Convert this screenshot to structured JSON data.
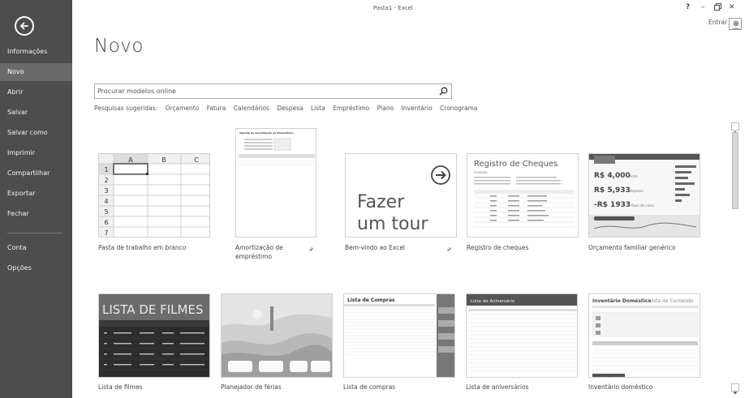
{
  "window": {
    "title": "Pasta1 - Excel",
    "help": "?",
    "minimize": "–",
    "restore": "🗗",
    "close": "✕",
    "signin": "Entrar"
  },
  "sidebar": {
    "items": [
      {
        "label": "Informações"
      },
      {
        "label": "Novo",
        "active": true
      },
      {
        "label": "Abrir"
      },
      {
        "label": "Salvar"
      },
      {
        "label": "Salvar como"
      },
      {
        "label": "Imprimir"
      },
      {
        "label": "Compartilhar"
      },
      {
        "label": "Exportar"
      },
      {
        "label": "Fechar"
      },
      {
        "label": "Conta"
      },
      {
        "label": "Opções"
      }
    ]
  },
  "main": {
    "heading": "Novo",
    "search": {
      "placeholder": "Procurar modelos online"
    },
    "suggestions": {
      "label": "Pesquisas sugeridas:",
      "items": [
        "Orçamento",
        "Fatura",
        "Calendários",
        "Despesa",
        "Lista",
        "Empréstimo",
        "Plano",
        "Inventário",
        "Cronograma"
      ]
    }
  },
  "templates": [
    {
      "caption": "Pasta de trabalho em branco",
      "cols": [
        "A",
        "B",
        "C"
      ],
      "rows": [
        "1",
        "2",
        "3",
        "4",
        "5",
        "6",
        "7"
      ]
    },
    {
      "caption": "Amortização de empréstimo",
      "pinned": true,
      "inner_title": "Agenda de Amortização de Empréstimo"
    },
    {
      "caption": "Bem-vindo ao Excel",
      "pinned": true,
      "line1": "Fazer",
      "line2": "um tour"
    },
    {
      "caption": "Registro de cheques",
      "inner_title": "Registro de Cheques",
      "legend": "LEGENDA"
    },
    {
      "caption": "Orçamento familiar genérico",
      "v1": "R$ 4,000",
      "l1": "renda",
      "v2": "R$ 5,933",
      "l2": "despesas",
      "v3": "-R$ 1933",
      "l3": "fluxo de caixa"
    },
    {
      "caption": "Lista de filmes",
      "inner_title": "LISTA DE FILMES"
    },
    {
      "caption": "Planejador de férias"
    },
    {
      "caption": "Lista de compras",
      "inner_title": "Lista de Compras"
    },
    {
      "caption": "Lista de aniversários",
      "inner_title": "Lista de Aniversário"
    },
    {
      "caption": "Inventário doméstico",
      "inner_title": "Inventário Doméstico",
      "inner_sub": "Lista de Conteúdo"
    }
  ],
  "colors": {
    "sidebar": "#4d4d4d",
    "sidebar_active": "#6a6a6a"
  }
}
